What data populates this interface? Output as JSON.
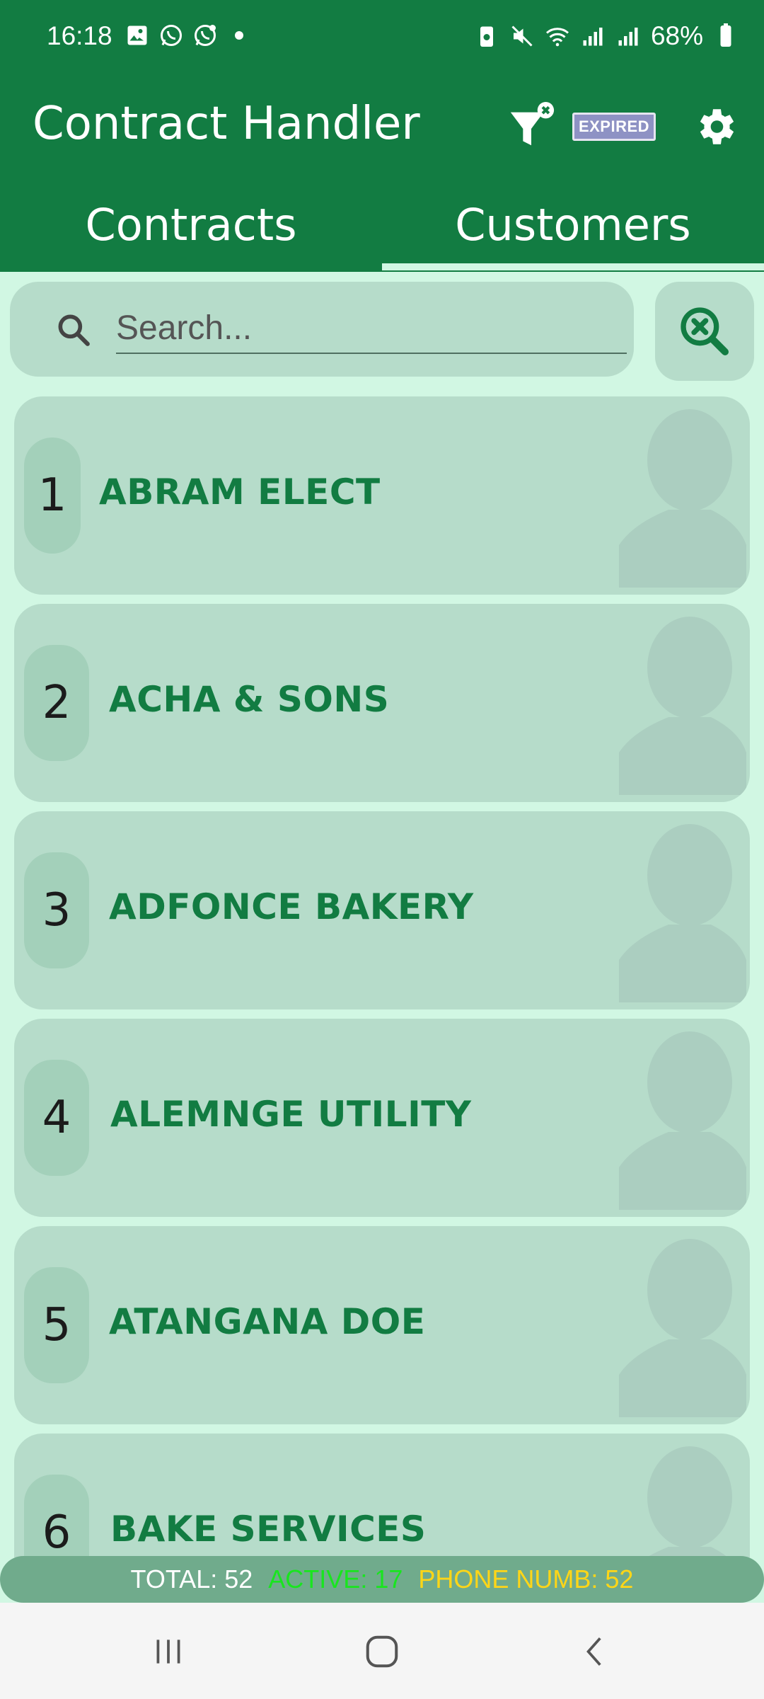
{
  "status_bar": {
    "time": "16:18",
    "battery": "68%"
  },
  "app_bar": {
    "title": "Contract Handler",
    "expired_label": "EXPIRED"
  },
  "tabs": [
    {
      "label": "Contracts"
    },
    {
      "label": "Customers"
    }
  ],
  "search": {
    "placeholder": "Search..."
  },
  "customers": [
    {
      "number": "1",
      "name": "ABRAM ELECT"
    },
    {
      "number": "2",
      "name": "ACHA & SONS"
    },
    {
      "number": "3",
      "name": "ADFONCE BAKERY"
    },
    {
      "number": "4",
      "name": "ALEMNGE UTILITY"
    },
    {
      "number": "5",
      "name": "ATANGANA DOE"
    },
    {
      "number": "6",
      "name": "BAKE SERVICES"
    }
  ],
  "footer": {
    "total": "TOTAL: 52",
    "active": "ACTIVE: 17",
    "phone": "PHONE NUMB: 52"
  },
  "colors": {
    "primary": "#127c42",
    "background": "#d1f7e3",
    "card": "#b6dcca",
    "active": "#19e51f",
    "phone": "#ffd617"
  }
}
